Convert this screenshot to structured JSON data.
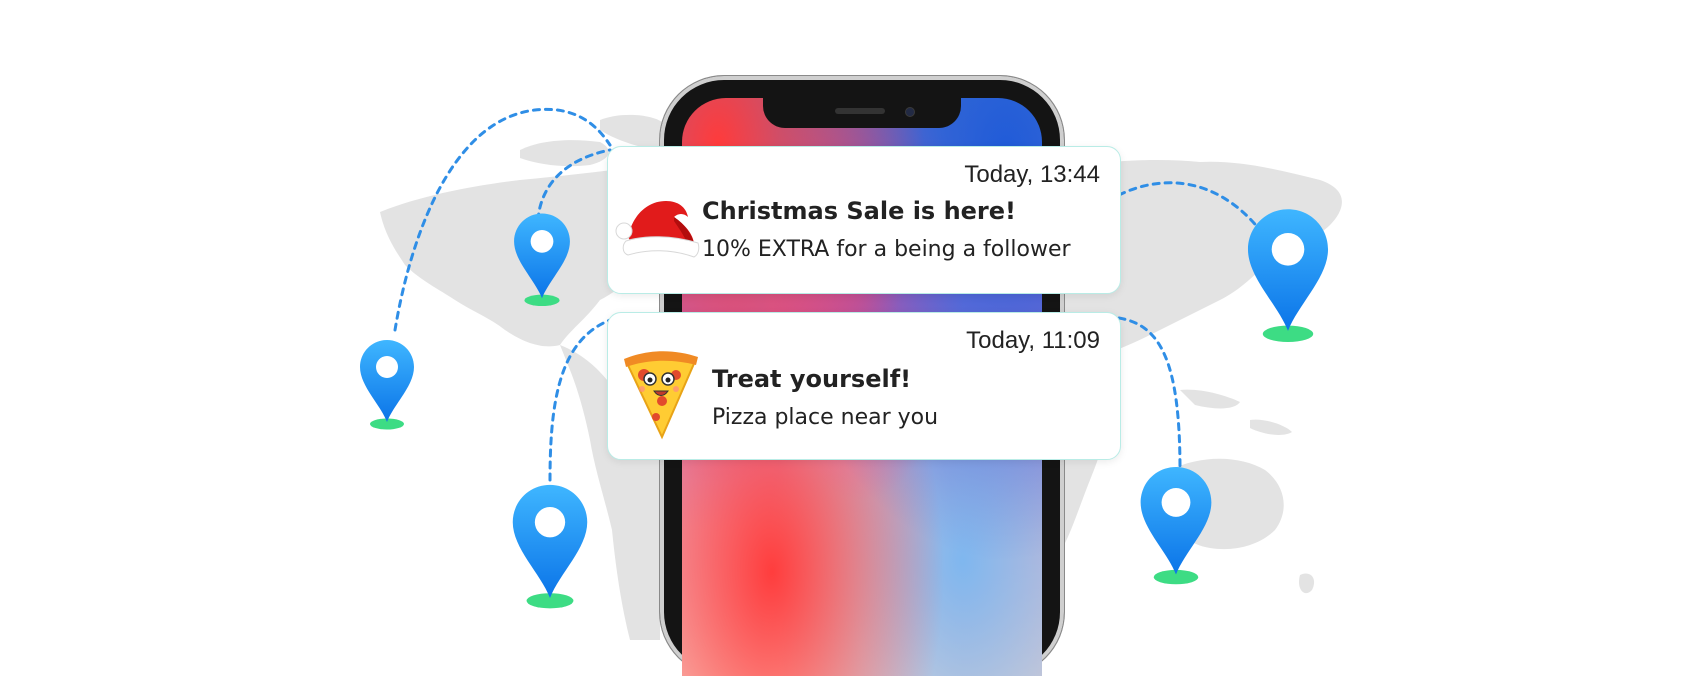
{
  "notifications": [
    {
      "time": "Today, 13:44",
      "title": "Christmas Sale is here!",
      "body": "10% EXTRA for a being a follower",
      "icon": "santa-hat-icon"
    },
    {
      "time": "Today, 11:09",
      "title": "Treat yourself!",
      "body": "Pizza place near you",
      "icon": "pizza-slice-icon"
    }
  ],
  "icons": {
    "location_pin": "location-pin-icon",
    "world_map": "world-map"
  },
  "colors": {
    "pin_blue": "#1e9bf0",
    "pin_base": "#3ddc84",
    "route": "#2f8ee6",
    "map_gray": "#e2e2e2",
    "notification_border": "#b9ece6"
  }
}
